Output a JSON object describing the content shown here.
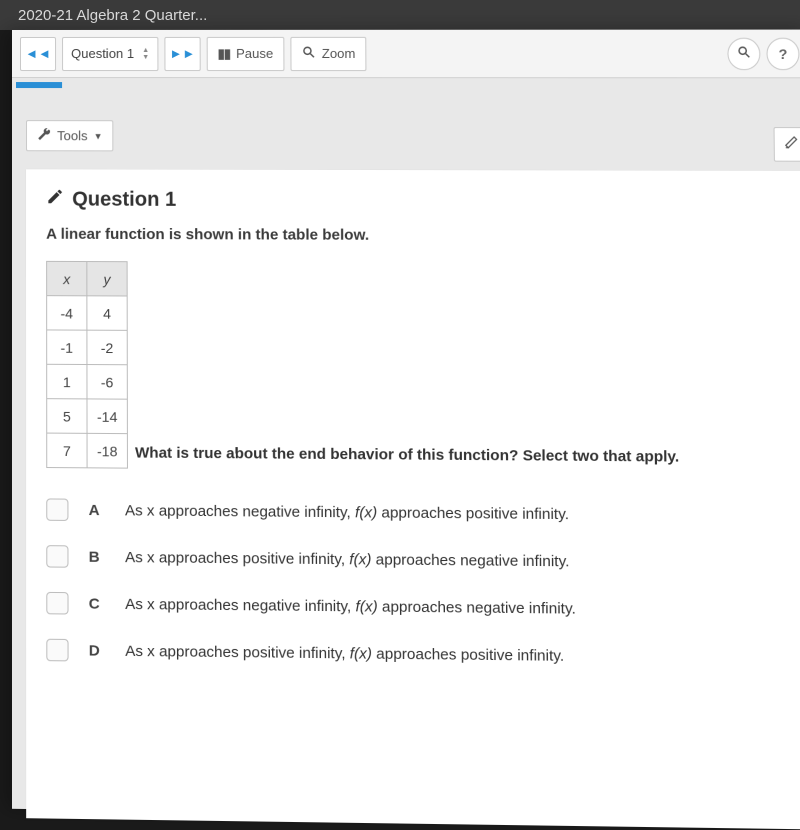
{
  "tab": {
    "title": "2020-21 Algebra 2 Quarter..."
  },
  "toolbar": {
    "question_selector": "Question 1",
    "pause": "Pause",
    "zoom": "Zoom"
  },
  "tools": {
    "label": "Tools"
  },
  "question": {
    "title": "Question 1",
    "intro": "A linear function is shown in the table below.",
    "table": {
      "headers": [
        "x",
        "y"
      ],
      "rows": [
        [
          "-4",
          "4"
        ],
        [
          "-1",
          "-2"
        ],
        [
          "1",
          "-6"
        ],
        [
          "5",
          "-14"
        ],
        [
          "7",
          "-18"
        ]
      ]
    },
    "prompt": "What is true about the end behavior of this function? Select two that apply.",
    "choices": [
      {
        "letter": "A",
        "text_pre": "As x approaches negative infinity, ",
        "fx": "f(x)",
        "text_post": " approaches positive infinity."
      },
      {
        "letter": "B",
        "text_pre": "As x approaches positive infinity, ",
        "fx": "f(x)",
        "text_post": " approaches negative infinity."
      },
      {
        "letter": "C",
        "text_pre": "As x approaches negative infinity, ",
        "fx": "f(x)",
        "text_post": " approaches negative infinity."
      },
      {
        "letter": "D",
        "text_pre": "As x approaches positive infinity, ",
        "fx": "f(x)",
        "text_post": " approaches positive infinity."
      }
    ]
  }
}
